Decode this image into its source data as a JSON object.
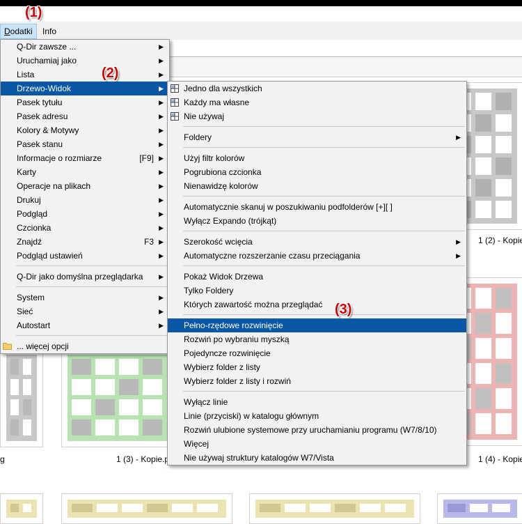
{
  "annotations": [
    "(1)",
    "(2)",
    "(3)"
  ],
  "menubar": {
    "items": [
      "Dodatki",
      "Info"
    ]
  },
  "main_menu": {
    "items": [
      {
        "label": "Q-Dir zawsze ...",
        "shortcut": "",
        "submenu": true
      },
      {
        "label": "Uruchamiaj jako",
        "shortcut": "",
        "submenu": true
      },
      {
        "label": "Lista",
        "shortcut": "",
        "submenu": true
      },
      {
        "label": "Drzewo-Widok",
        "shortcut": "",
        "submenu": true,
        "highlighted": true
      },
      {
        "label": "Pasek tytułu",
        "shortcut": "",
        "submenu": true
      },
      {
        "label": "Pasek adresu",
        "shortcut": "",
        "submenu": true
      },
      {
        "label": "Kolory & Motywy",
        "shortcut": "",
        "submenu": true
      },
      {
        "label": "Pasek stanu",
        "shortcut": "",
        "submenu": true
      },
      {
        "label": "Informacje o rozmiarze",
        "shortcut": "[F9]",
        "submenu": true
      },
      {
        "label": "Karty",
        "shortcut": "",
        "submenu": true
      },
      {
        "label": "Operacje na plikach",
        "shortcut": "",
        "submenu": true
      },
      {
        "label": "Drukuj",
        "shortcut": "",
        "submenu": true
      },
      {
        "label": "Podgląd",
        "shortcut": "",
        "submenu": true
      },
      {
        "label": "Czcionka",
        "shortcut": "",
        "submenu": true
      },
      {
        "label": "Znajdź",
        "shortcut": "F3",
        "submenu": true
      },
      {
        "label": "Podgląd ustawień",
        "shortcut": "",
        "submenu": true
      },
      {
        "separator": true
      },
      {
        "label": "Q-Dir jako domyślna przeglądarka",
        "shortcut": "",
        "submenu": true
      },
      {
        "separator": true
      },
      {
        "label": "System",
        "shortcut": "",
        "submenu": true
      },
      {
        "label": "Sieć",
        "shortcut": "",
        "submenu": true
      },
      {
        "label": "Autostart",
        "shortcut": "",
        "submenu": true
      },
      {
        "separator": true
      },
      {
        "label": "... więcej opcji",
        "shortcut": "",
        "submenu": false,
        "icon": "folder-icon"
      }
    ]
  },
  "sub_menu": {
    "items": [
      {
        "label": "Jedno dla wszystkich",
        "icon": "grid-icon"
      },
      {
        "label": "Każdy ma własne",
        "icon": "grid-icon"
      },
      {
        "label": "Nie używaj",
        "icon": "grid-icon"
      },
      {
        "separator": true
      },
      {
        "label": "Foldery",
        "submenu": true
      },
      {
        "separator": true
      },
      {
        "label": "Użyj filtr kolorów"
      },
      {
        "label": "Pogrubiona czcionka"
      },
      {
        "label": "Nienawidzę kolorów"
      },
      {
        "separator": true
      },
      {
        "label": "Automatycznie skanuj w poszukiwaniu podfolderów [+][ ]"
      },
      {
        "label": "Wyłącz Expando (trójkąt)"
      },
      {
        "separator": true
      },
      {
        "label": "Szerokość wcięcia",
        "submenu": true
      },
      {
        "label": "Automatyczne rozszerzanie czasu przeciągania",
        "submenu": true
      },
      {
        "separator": true
      },
      {
        "label": "Pokaż Widok Drzewa"
      },
      {
        "label": "Tylko Foldery"
      },
      {
        "label": "Których zawartość można przeglądać"
      },
      {
        "separator": true
      },
      {
        "label": "Pełno-rzędowe rozwinięcie",
        "highlighted": true
      },
      {
        "label": "Rozwiń po wybraniu myszką"
      },
      {
        "label": "Pojedyncze rozwinięcie"
      },
      {
        "label": "Wybierz folder z listy"
      },
      {
        "label": "Wybierz folder z listy i rozwiń"
      },
      {
        "separator": true
      },
      {
        "label": "Wyłącz linie"
      },
      {
        "label": "Linie (przyciski) w katalogu głównym"
      },
      {
        "label": "Rozwiń ulubione systemowe przy uruchamianiu programu (W7/8/10)"
      },
      {
        "label": "Więcej"
      },
      {
        "label": "Nie używaj struktury katalogów W7/Vista"
      }
    ]
  },
  "captions": [
    "1 (2) - Kopie",
    "g",
    "1 (3) - Kopie.p",
    "1 (4) - Kopie"
  ],
  "colors": {
    "highlight": "#0a57a6",
    "annotation": "#d40000",
    "thumb_gray": "#c8c8c8",
    "thumb_green": "#b7e3b0",
    "thumb_red": "#eeb4b4",
    "thumb_yellow": "#ebe3b0",
    "thumb_blue": "#b8b8ec"
  }
}
